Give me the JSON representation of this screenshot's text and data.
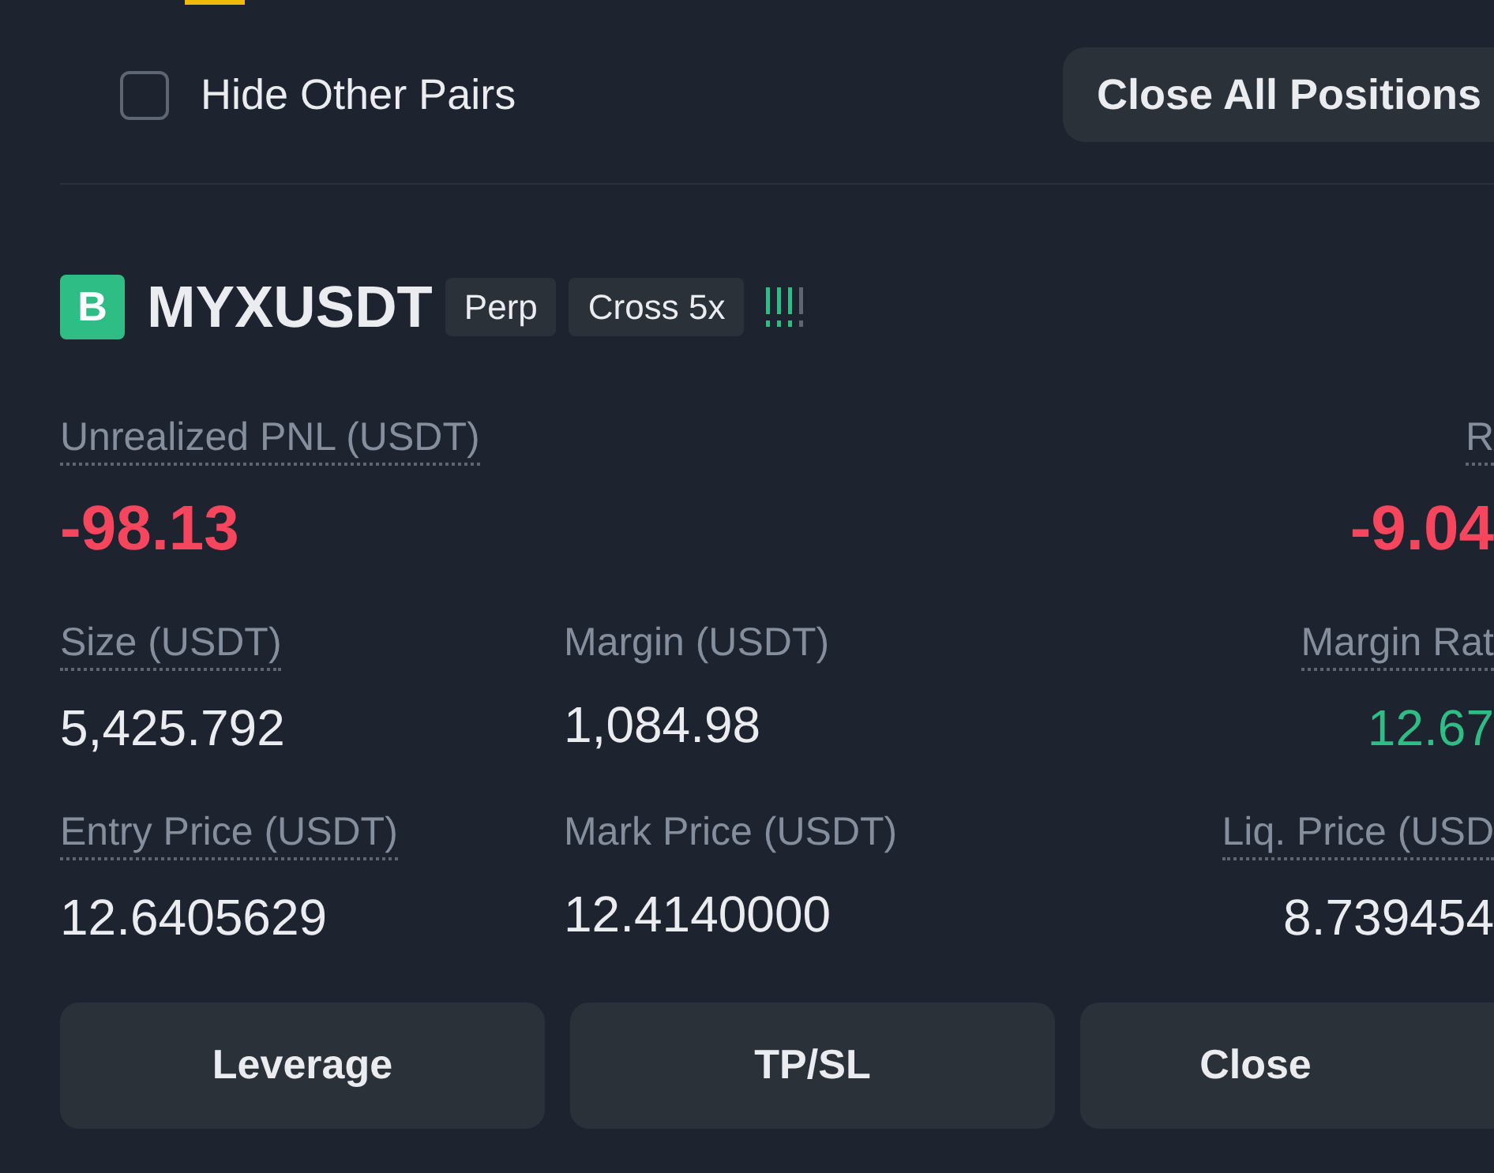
{
  "hide_other_pairs": {
    "label": "Hide Other Pairs",
    "checked": false
  },
  "close_all_button": {
    "label": "Close All Positions"
  },
  "position": {
    "badge": "B",
    "symbol": "MYXUSDT",
    "tags": [
      "Perp",
      "Cross 5x"
    ],
    "headline": [
      {
        "label": "Unrealized PNL (USDT)",
        "value": "-98.13",
        "color": "#f6465d",
        "tooltip": true
      },
      {
        "label": "R",
        "value": "-9.04",
        "color": "#f6465d",
        "tooltip": true
      }
    ],
    "stats": [
      [
        {
          "label": "Size (USDT)",
          "value": "5,425.792",
          "color": "#eaecef",
          "tooltip": true
        },
        {
          "label": "Margin (USDT)",
          "value": "1,084.98",
          "color": "#eaecef",
          "tooltip": false
        },
        {
          "label": "Margin Rat",
          "value": "12.67",
          "color": "#2ebd85",
          "tooltip": true
        }
      ],
      [
        {
          "label": "Entry Price (USDT)",
          "value": "12.6405629",
          "color": "#eaecef",
          "tooltip": true
        },
        {
          "label": "Mark Price (USDT)",
          "value": "12.4140000",
          "color": "#eaecef",
          "tooltip": false
        },
        {
          "label": "Liq. Price (USD",
          "value": "8.739454",
          "color": "#eaecef",
          "tooltip": true
        }
      ]
    ],
    "actions": [
      "Leverage",
      "TP/SL",
      "Close"
    ]
  }
}
